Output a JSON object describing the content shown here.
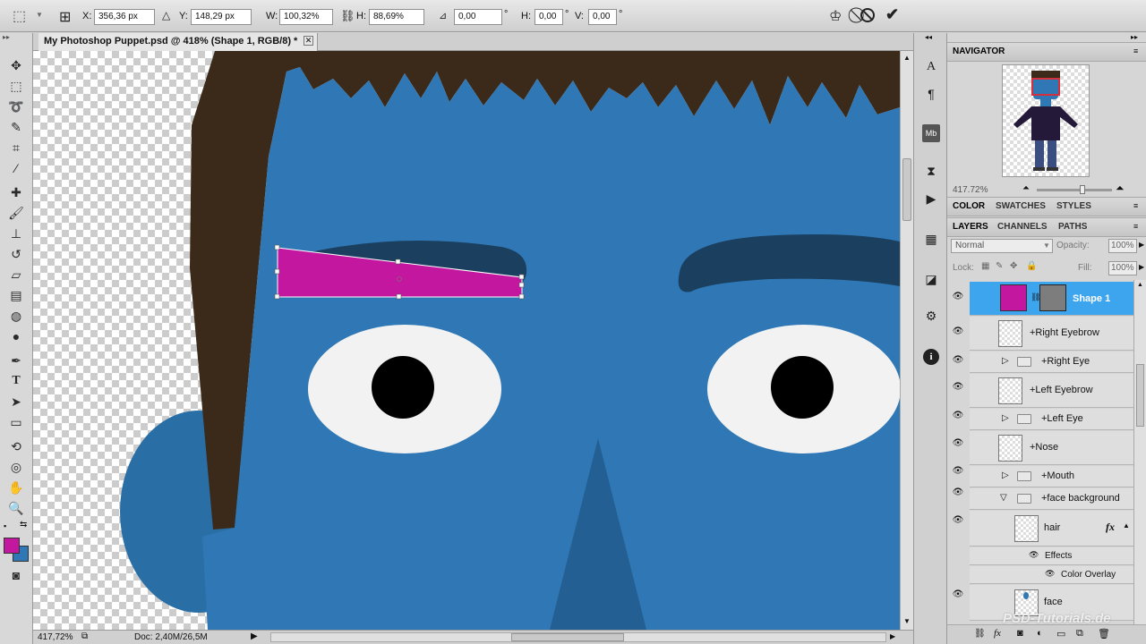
{
  "options": {
    "x_label": "X:",
    "x_value": "356,36 px",
    "y_label": "Y:",
    "y_value": "148,29 px",
    "w_label": "W:",
    "w_value": "100,32%",
    "h_label": "H:",
    "h_value": "88,69%",
    "angle_value": "0,00",
    "degree": "°",
    "hskew_label": "H:",
    "hskew_value": "0,00",
    "vskew_label": "V:",
    "vskew_value": "0,00"
  },
  "document": {
    "tab_title": "My Photoshop Puppet.psd @ 418% (Shape 1, RGB/8) *",
    "zoom": "417,72%",
    "doc_info": "Doc: 2,40M/26,5M"
  },
  "navigator": {
    "title": "NAVIGATOR",
    "zoom": "417.72%"
  },
  "color_panel": {
    "tabs": [
      "COLOR",
      "SWATCHES",
      "STYLES"
    ]
  },
  "layers_panel": {
    "tabs": [
      "LAYERS",
      "CHANNELS",
      "PATHS"
    ],
    "blend_mode": "Normal",
    "opacity_label": "Opacity:",
    "opacity_value": "100%",
    "lock_label": "Lock:",
    "fill_label": "Fill:",
    "fill_value": "100%",
    "layers": {
      "shape1": "Shape 1",
      "right_eyebrow": "+Right Eyebrow",
      "right_eye": "+Right Eye",
      "left_eyebrow": "+Left Eyebrow",
      "left_eye": "+Left Eye",
      "nose": "+Nose",
      "mouth": "+Mouth",
      "face_background": "+face background",
      "hair": "hair",
      "effects": "Effects",
      "color_overlay": "Color Overlay",
      "face": "face"
    },
    "fx_label": "fx"
  },
  "watermark": "PSD-Tutorials.de",
  "colors": {
    "foreground": "#c4179f",
    "background": "#2f78b5",
    "face": "#2f78b5",
    "hair": "#3b2a1a",
    "brow": "#1b3f5e",
    "selection": "#3da5ee"
  }
}
